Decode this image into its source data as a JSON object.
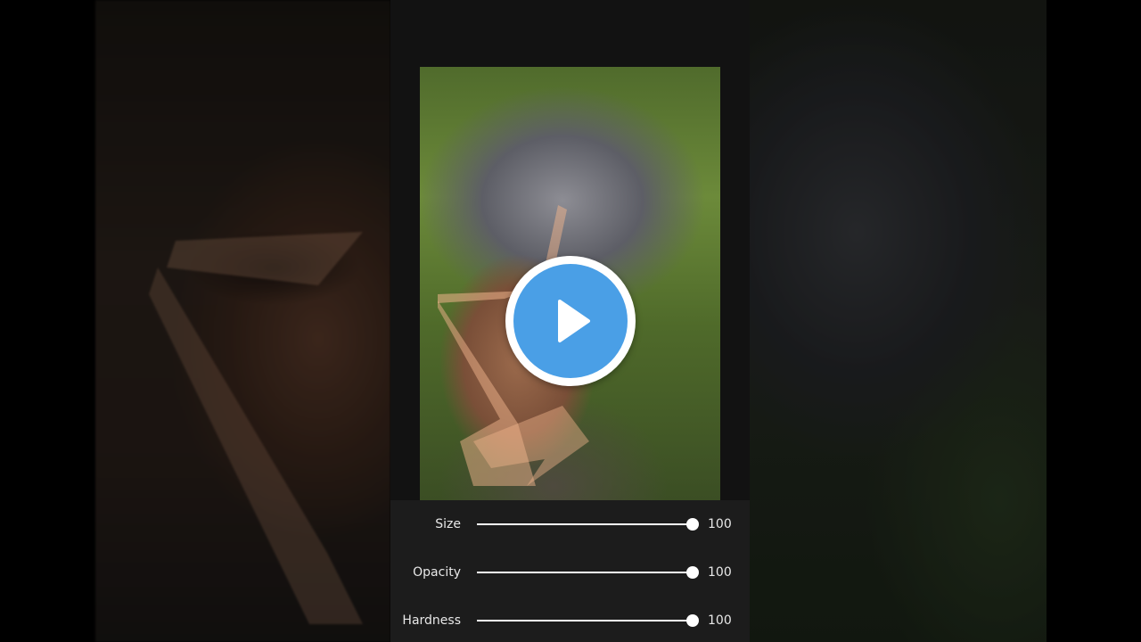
{
  "player": {
    "play_icon": "play-icon",
    "accent_color": "#4a9fe6"
  },
  "editor": {
    "sliders": [
      {
        "label": "Size",
        "value": "100",
        "fraction": 1.0
      },
      {
        "label": "Opacity",
        "value": "100",
        "fraction": 1.0
      },
      {
        "label": "Hardness",
        "value": "100",
        "fraction": 1.0
      }
    ]
  }
}
